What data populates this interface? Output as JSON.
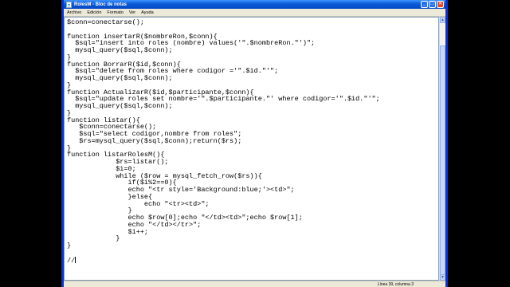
{
  "window": {
    "title": "RolesM - Bloc de notas"
  },
  "window_buttons": {
    "minimize": "_",
    "maximize": "□",
    "close": "×"
  },
  "menu": [
    "Archivo",
    "Edición",
    "Formato",
    "Ver",
    "Ayuda"
  ],
  "editor": {
    "lines": [
      "$conn=conectarse();",
      "",
      "function insertarR($nombreRon,$conn){",
      "  $sql=\"insert into roles (nombre) values('\".$nombreRon.\"')\";",
      "  mysql_query($sql,$conn);",
      "}",
      "function BorrarR($id,$conn){",
      "  $sql=\"delete from roles where codigor ='\".$id.\"'\";",
      "  mysql_query($sql,$conn);",
      "}",
      "function ActualizarR($id,$participante,$conn){",
      "  $sql=\"update roles set nombre='\".$participante.\"' where codigor='\".$id.\"'\";",
      "  mysql_query($sql,$conn);",
      "}",
      "function listar(){",
      "   $conn=conectarse();",
      "   $sql=\"select codigor,nombre from roles\";",
      "   $rs=mysql_query($sql,$conn);return($rs);",
      "}",
      "function listarRolesM(){",
      "            $rs=listar();",
      "            $i=0;",
      "            while ($row = mysql_fetch_row($rs)){",
      "               if($i%2==0){",
      "               echo \"<tr style='Background:blue;'><td>\";",
      "               }else{",
      "                   echo \"<tr><td>\";",
      "               }",
      "               echo $row[0];echo \"</td><td>\";echo $row[1];",
      "               echo \"</td></tr>\";",
      "               $i++;",
      "            }",
      "}",
      "",
      "//"
    ]
  },
  "status": {
    "position": "Línea 39, columna 3"
  }
}
